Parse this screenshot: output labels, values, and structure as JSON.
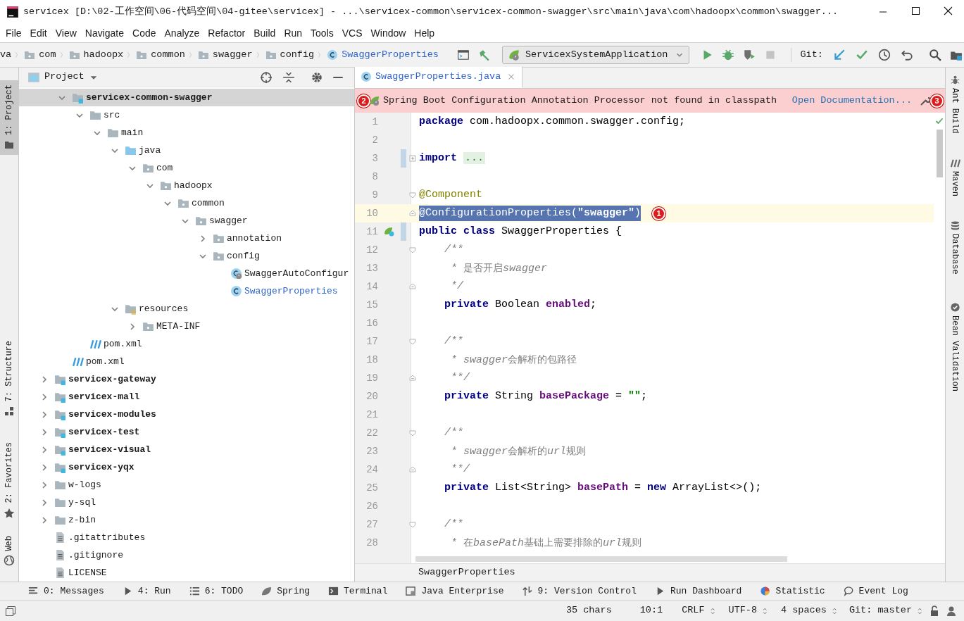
{
  "window": {
    "title": "servicex [D:\\02-工作空间\\06-代码空间\\04-gitee\\servicex] - ...\\servicex-common\\servicex-common-swagger\\src\\main\\java\\com\\hadoopx\\common\\swagger..."
  },
  "menu": [
    "File",
    "Edit",
    "View",
    "Navigate",
    "Code",
    "Analyze",
    "Refactor",
    "Build",
    "Run",
    "Tools",
    "VCS",
    "Window",
    "Help"
  ],
  "breadcrumbs": [
    {
      "label": "va",
      "kind": "text"
    },
    {
      "label": "com",
      "kind": "package"
    },
    {
      "label": "hadoopx",
      "kind": "package"
    },
    {
      "label": "common",
      "kind": "package"
    },
    {
      "label": "swagger",
      "kind": "package"
    },
    {
      "label": "config",
      "kind": "package"
    },
    {
      "label": "SwaggerProperties",
      "kind": "class"
    }
  ],
  "toolbar": {
    "run_config": "ServicexSystemApplication",
    "git_label": "Git:"
  },
  "left_strip": [
    {
      "label": "1: Project",
      "kind": "project",
      "selected": true
    },
    {
      "label": "7: Structure",
      "kind": "structure",
      "selected": false
    },
    {
      "label": "2: Favorites",
      "kind": "favorites",
      "selected": false
    },
    {
      "label": "Web",
      "kind": "web",
      "selected": false
    }
  ],
  "project_panel": {
    "title": "Project",
    "tree": {
      "continued_items": [
        {
          "label": "servicex-common-swagger",
          "kind": "module",
          "expanded": true,
          "selected": true,
          "children": [
            {
              "label": "src",
              "kind": "folder",
              "expanded": true,
              "selected": false,
              "children": [
                {
                  "label": "main",
                  "kind": "folder",
                  "expanded": true,
                  "selected": false,
                  "children": [
                    {
                      "label": "java",
                      "kind": "source_root",
                      "expanded": true,
                      "selected": false,
                      "children": [
                        {
                          "label": "com",
                          "kind": "package",
                          "expanded": true,
                          "selected": false,
                          "children": [
                            {
                              "label": "hadoopx",
                              "kind": "package",
                              "expanded": true,
                              "selected": false,
                              "children": [
                                {
                                  "label": "common",
                                  "kind": "package",
                                  "expanded": true,
                                  "selected": false,
                                  "children": [
                                    {
                                      "label": "swagger",
                                      "kind": "package",
                                      "expanded": true,
                                      "selected": false,
                                      "children": [
                                        {
                                          "label": "annotation",
                                          "kind": "package",
                                          "expanded": false,
                                          "selected": false
                                        },
                                        {
                                          "label": "config",
                                          "kind": "package",
                                          "expanded": true,
                                          "selected": false,
                                          "children": [
                                            {
                                              "label": "SwaggerAutoConfigur",
                                              "kind": "spring_class",
                                              "modified": false,
                                              "selected": false
                                            },
                                            {
                                              "label": "SwaggerProperties",
                                              "kind": "class",
                                              "modified": true,
                                              "selected": false
                                            }
                                          ]
                                        }
                                      ]
                                    }
                                  ]
                                }
                              ]
                            }
                          ]
                        }
                      ]
                    },
                    {
                      "label": "resources",
                      "kind": "resources",
                      "expanded": true,
                      "selected": false,
                      "children": [
                        {
                          "label": "META-INF",
                          "kind": "package",
                          "expanded": false,
                          "selected": false
                        }
                      ]
                    }
                  ]
                }
              ]
            },
            {
              "label": "pom.xml",
              "kind": "maven",
              "selected": false
            }
          ]
        },
        {
          "label": "pom.xml",
          "kind": "maven",
          "selected": false
        }
      ],
      "items": [
        {
          "label": "servicex-gateway",
          "kind": "module",
          "expanded": false,
          "selected": false
        },
        {
          "label": "servicex-mall",
          "kind": "module",
          "expanded": false,
          "selected": false
        },
        {
          "label": "servicex-modules",
          "kind": "module",
          "expanded": false,
          "selected": false
        },
        {
          "label": "servicex-test",
          "kind": "module",
          "expanded": false,
          "selected": false
        },
        {
          "label": "servicex-visual",
          "kind": "module",
          "expanded": false,
          "selected": false
        },
        {
          "label": "servicex-yqx",
          "kind": "module",
          "expanded": false,
          "selected": false
        },
        {
          "label": "w-logs",
          "kind": "folder",
          "expanded": false,
          "selected": false
        },
        {
          "label": "y-sql",
          "kind": "folder",
          "expanded": false,
          "selected": false
        },
        {
          "label": "z-bin",
          "kind": "folder",
          "expanded": false,
          "selected": false
        },
        {
          "label": ".gitattributes",
          "kind": "file",
          "selected": false
        },
        {
          "label": ".gitignore",
          "kind": "file",
          "selected": false
        },
        {
          "label": "LICENSE",
          "kind": "file",
          "selected": false
        }
      ]
    }
  },
  "editor": {
    "tabs": [
      {
        "label": "SwaggerProperties.java",
        "selected": true,
        "modified": true
      }
    ],
    "banner": {
      "marker_start": "2",
      "message": "Spring Boot Configuration Annotation Processor not found in classpath",
      "link": "Open Documentation...",
      "marker_end": "3"
    },
    "lines": [
      {
        "number": "1",
        "tokens": [
          {
            "kind": "kw",
            "text": "package"
          },
          {
            "kind": "text",
            "text": " com.hadoopx.common.swagger.config;"
          }
        ]
      },
      {
        "number": "2"
      },
      {
        "number": "3",
        "changed": true,
        "fold": {
          "kind": "plus"
        },
        "tokens": [
          {
            "kind": "kw",
            "text": "import "
          },
          {
            "kind": "folded",
            "text": "..."
          }
        ]
      },
      {
        "number": "8"
      },
      {
        "number": "9",
        "fold": {
          "kind": "start"
        },
        "tokens": [
          {
            "kind": "ann",
            "text": "@Component"
          }
        ]
      },
      {
        "number": "10",
        "current": true,
        "selected": true,
        "fold": {
          "kind": "end"
        },
        "marker": "1",
        "tokens": [
          {
            "kind": "ann",
            "text": "@ConfigurationProperties("
          },
          {
            "kind": "str",
            "text": "\"swagger\""
          },
          {
            "kind": "ann",
            "text": ")"
          }
        ]
      },
      {
        "number": "11",
        "changed": true,
        "gutter_icon": {
          "kind": "bean"
        },
        "tokens": [
          {
            "kind": "kw",
            "text": "public class"
          },
          {
            "kind": "text",
            "text": " SwaggerProperties {"
          }
        ]
      },
      {
        "number": "12",
        "fold": {
          "kind": "start"
        },
        "tokens": [
          {
            "kind": "doc",
            "text": "    /**"
          }
        ]
      },
      {
        "number": "13",
        "tokens": [
          {
            "kind": "doc",
            "text": "     * "
          },
          {
            "kind": "doc_plain",
            "text": "是否开启"
          },
          {
            "kind": "doc",
            "text": "swagger"
          }
        ]
      },
      {
        "number": "14",
        "fold": {
          "kind": "end"
        },
        "tokens": [
          {
            "kind": "doc",
            "text": "     */"
          }
        ]
      },
      {
        "number": "15",
        "tokens": [
          {
            "kind": "kw",
            "text": "    private"
          },
          {
            "kind": "text",
            "text": " Boolean "
          },
          {
            "kind": "field",
            "text": "enabled"
          },
          {
            "kind": "text",
            "text": ";"
          }
        ]
      },
      {
        "number": "16"
      },
      {
        "number": "17",
        "fold": {
          "kind": "start"
        },
        "tokens": [
          {
            "kind": "doc",
            "text": "    /**"
          }
        ]
      },
      {
        "number": "18",
        "tokens": [
          {
            "kind": "doc",
            "text": "     * swagger"
          },
          {
            "kind": "doc_plain",
            "text": "会解析的包路径"
          }
        ]
      },
      {
        "number": "19",
        "fold": {
          "kind": "end"
        },
        "tokens": [
          {
            "kind": "doc",
            "text": "     **/"
          }
        ]
      },
      {
        "number": "20",
        "tokens": [
          {
            "kind": "kw",
            "text": "    private"
          },
          {
            "kind": "text",
            "text": " String "
          },
          {
            "kind": "field",
            "text": "basePackage"
          },
          {
            "kind": "text",
            "text": " = "
          },
          {
            "kind": "str",
            "text": "\"\""
          },
          {
            "kind": "text",
            "text": ";"
          }
        ]
      },
      {
        "number": "21"
      },
      {
        "number": "22",
        "fold": {
          "kind": "start"
        },
        "tokens": [
          {
            "kind": "doc",
            "text": "    /**"
          }
        ]
      },
      {
        "number": "23",
        "tokens": [
          {
            "kind": "doc",
            "text": "     * swagger"
          },
          {
            "kind": "doc_plain",
            "text": "会解析的"
          },
          {
            "kind": "doc",
            "text": "url"
          },
          {
            "kind": "doc_plain",
            "text": "规则"
          }
        ]
      },
      {
        "number": "24",
        "fold": {
          "kind": "end"
        },
        "tokens": [
          {
            "kind": "doc",
            "text": "     **/"
          }
        ]
      },
      {
        "number": "25",
        "tokens": [
          {
            "kind": "kw",
            "text": "    private"
          },
          {
            "kind": "text",
            "text": " List<String> "
          },
          {
            "kind": "field",
            "text": "basePath"
          },
          {
            "kind": "text",
            "text": " = "
          },
          {
            "kind": "kw",
            "text": "new"
          },
          {
            "kind": "text",
            "text": " ArrayList<>();"
          }
        ]
      },
      {
        "number": "26"
      },
      {
        "number": "27",
        "fold": {
          "kind": "start"
        },
        "tokens": [
          {
            "kind": "doc",
            "text": "    /**"
          }
        ]
      },
      {
        "number": "28",
        "tokens": [
          {
            "kind": "doc",
            "text": "     * "
          },
          {
            "kind": "doc_plain",
            "text": "在"
          },
          {
            "kind": "doc",
            "text": "basePath"
          },
          {
            "kind": "doc_plain",
            "text": "基础上需要排除的"
          },
          {
            "kind": "doc",
            "text": "url"
          },
          {
            "kind": "doc_plain",
            "text": "规则"
          }
        ]
      }
    ],
    "breadcrumb": "SwaggerProperties"
  },
  "right_strip": [
    {
      "label": "Ant Build",
      "kind": "ant"
    },
    {
      "label": "Maven",
      "kind": "maven"
    },
    {
      "label": "Database",
      "kind": "database"
    },
    {
      "label": "Bean Validation",
      "kind": "bean"
    }
  ],
  "bottom_tools": [
    {
      "label": "0: Messages",
      "kind": "messages"
    },
    {
      "label": "4: Run",
      "kind": "run"
    },
    {
      "label": "6: TODO",
      "kind": "todo"
    },
    {
      "label": "Spring",
      "kind": "spring"
    },
    {
      "label": "Terminal",
      "kind": "terminal"
    },
    {
      "label": "Java Enterprise",
      "kind": "enterprise"
    },
    {
      "label": "9: Version Control",
      "kind": "vcs"
    },
    {
      "label": "Run Dashboard",
      "kind": "run"
    },
    {
      "label": "Statistic",
      "kind": "statistic"
    },
    {
      "label": "Event Log",
      "kind": "log"
    }
  ],
  "status_bar": {
    "chars": "35 chars",
    "position": "10:1",
    "line_ending": "CRLF",
    "encoding": "UTF-8",
    "indent": "4 spaces",
    "vcs": "Git: master"
  }
}
